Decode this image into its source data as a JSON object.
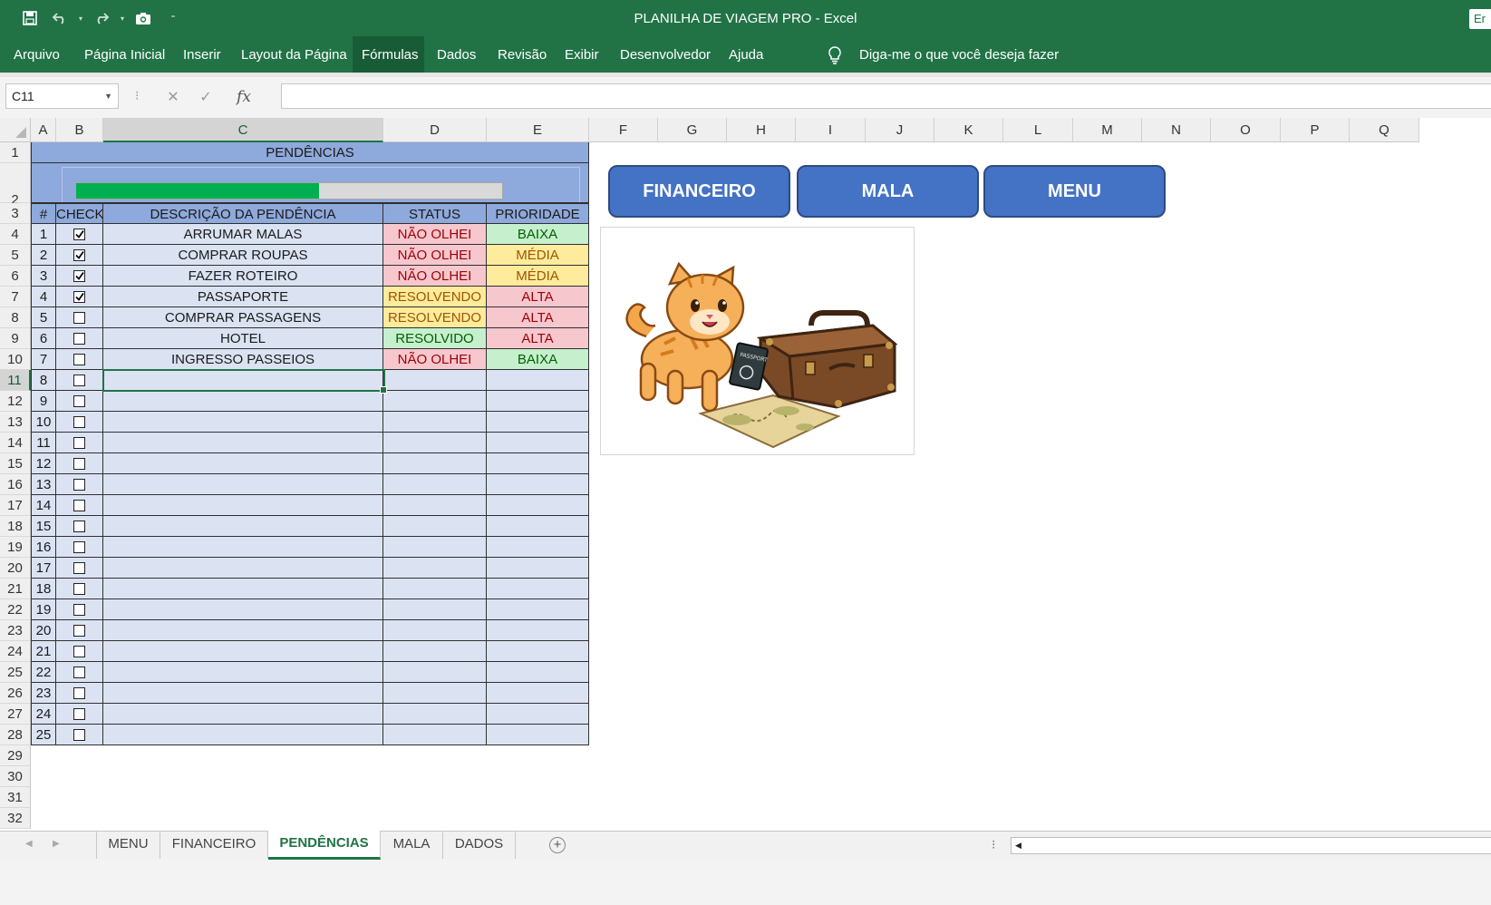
{
  "window": {
    "title": "PLANILHA DE VIAGEM PRO  -  Excel",
    "signin_partial": "Er"
  },
  "ribbon": {
    "tabs": [
      "Arquivo",
      "Página Inicial",
      "Inserir",
      "Layout da Página",
      "Fórmulas",
      "Dados",
      "Revisão",
      "Exibir",
      "Desenvolvedor",
      "Ajuda"
    ],
    "active_tab": "Fórmulas",
    "tell_me": "Diga-me o que você deseja fazer"
  },
  "formula_bar": {
    "name_box": "C11",
    "fx": "fx",
    "formula": ""
  },
  "columns": [
    "A",
    "B",
    "C",
    "D",
    "E",
    "F",
    "G",
    "H",
    "I",
    "J",
    "K",
    "L",
    "M",
    "N",
    "O",
    "P",
    "Q"
  ],
  "row_numbers": [
    "1",
    "2",
    "3",
    "4",
    "5",
    "6",
    "7",
    "8",
    "9",
    "10",
    "11",
    "12",
    "13",
    "14",
    "15",
    "16",
    "17",
    "18",
    "19",
    "20",
    "21",
    "22",
    "23",
    "24",
    "25",
    "26",
    "27",
    "28",
    "29",
    "30",
    "31",
    "32"
  ],
  "table": {
    "title": "PENDÊNCIAS",
    "progress": 0.57,
    "headers": {
      "num": "#",
      "check": "CHECK",
      "desc": "DESCRIÇÃO DA PENDÊNCIA",
      "status": "STATUS",
      "priority": "PRIORIDADE"
    },
    "rows": [
      {
        "n": "1",
        "checked": true,
        "desc": "ARRUMAR MALAS",
        "status": "NÃO OLHEI",
        "priority": "BAIXA"
      },
      {
        "n": "2",
        "checked": true,
        "desc": "COMPRAR ROUPAS",
        "status": "NÃO OLHEI",
        "priority": "MÉDIA"
      },
      {
        "n": "3",
        "checked": true,
        "desc": "FAZER ROTEIRO",
        "status": "NÃO OLHEI",
        "priority": "MÉDIA"
      },
      {
        "n": "4",
        "checked": true,
        "desc": "PASSAPORTE",
        "status": "RESOLVENDO",
        "priority": "ALTA"
      },
      {
        "n": "5",
        "checked": false,
        "desc": "COMPRAR PASSAGENS",
        "status": "RESOLVENDO",
        "priority": "ALTA"
      },
      {
        "n": "6",
        "checked": false,
        "desc": "HOTEL",
        "status": "RESOLVIDO",
        "priority": "ALTA"
      },
      {
        "n": "7",
        "checked": false,
        "desc": "INGRESSO PASSEIOS",
        "status": "NÃO OLHEI",
        "priority": "BAIXA"
      },
      {
        "n": "8",
        "checked": false,
        "desc": "",
        "status": "",
        "priority": ""
      },
      {
        "n": "9",
        "checked": false,
        "desc": "",
        "status": "",
        "priority": ""
      },
      {
        "n": "10",
        "checked": false,
        "desc": "",
        "status": "",
        "priority": ""
      },
      {
        "n": "11",
        "checked": false,
        "desc": "",
        "status": "",
        "priority": ""
      },
      {
        "n": "12",
        "checked": false,
        "desc": "",
        "status": "",
        "priority": ""
      },
      {
        "n": "13",
        "checked": false,
        "desc": "",
        "status": "",
        "priority": ""
      },
      {
        "n": "14",
        "checked": false,
        "desc": "",
        "status": "",
        "priority": ""
      },
      {
        "n": "15",
        "checked": false,
        "desc": "",
        "status": "",
        "priority": ""
      },
      {
        "n": "16",
        "checked": false,
        "desc": "",
        "status": "",
        "priority": ""
      },
      {
        "n": "17",
        "checked": false,
        "desc": "",
        "status": "",
        "priority": ""
      },
      {
        "n": "18",
        "checked": false,
        "desc": "",
        "status": "",
        "priority": ""
      },
      {
        "n": "19",
        "checked": false,
        "desc": "",
        "status": "",
        "priority": ""
      },
      {
        "n": "20",
        "checked": false,
        "desc": "",
        "status": "",
        "priority": ""
      },
      {
        "n": "21",
        "checked": false,
        "desc": "",
        "status": "",
        "priority": ""
      },
      {
        "n": "22",
        "checked": false,
        "desc": "",
        "status": "",
        "priority": ""
      },
      {
        "n": "23",
        "checked": false,
        "desc": "",
        "status": "",
        "priority": ""
      },
      {
        "n": "24",
        "checked": false,
        "desc": "",
        "status": "",
        "priority": ""
      },
      {
        "n": "25",
        "checked": false,
        "desc": "",
        "status": "",
        "priority": ""
      }
    ]
  },
  "buttons": {
    "financeiro": "FINANCEIRO",
    "mala": "MALA",
    "menu": "MENU"
  },
  "image": {
    "passport_text": "PASSPORT"
  },
  "sheet_tabs": [
    "MENU",
    "FINANCEIRO",
    "PENDÊNCIAS",
    "MALA",
    "DADOS"
  ],
  "active_sheet": "PENDÊNCIAS",
  "colors": {
    "excel_green": "#217346",
    "header_blue": "#8ea9db",
    "row_blue": "#dbe3f3",
    "button_blue": "#4472c4",
    "progress_green": "#00b050"
  }
}
